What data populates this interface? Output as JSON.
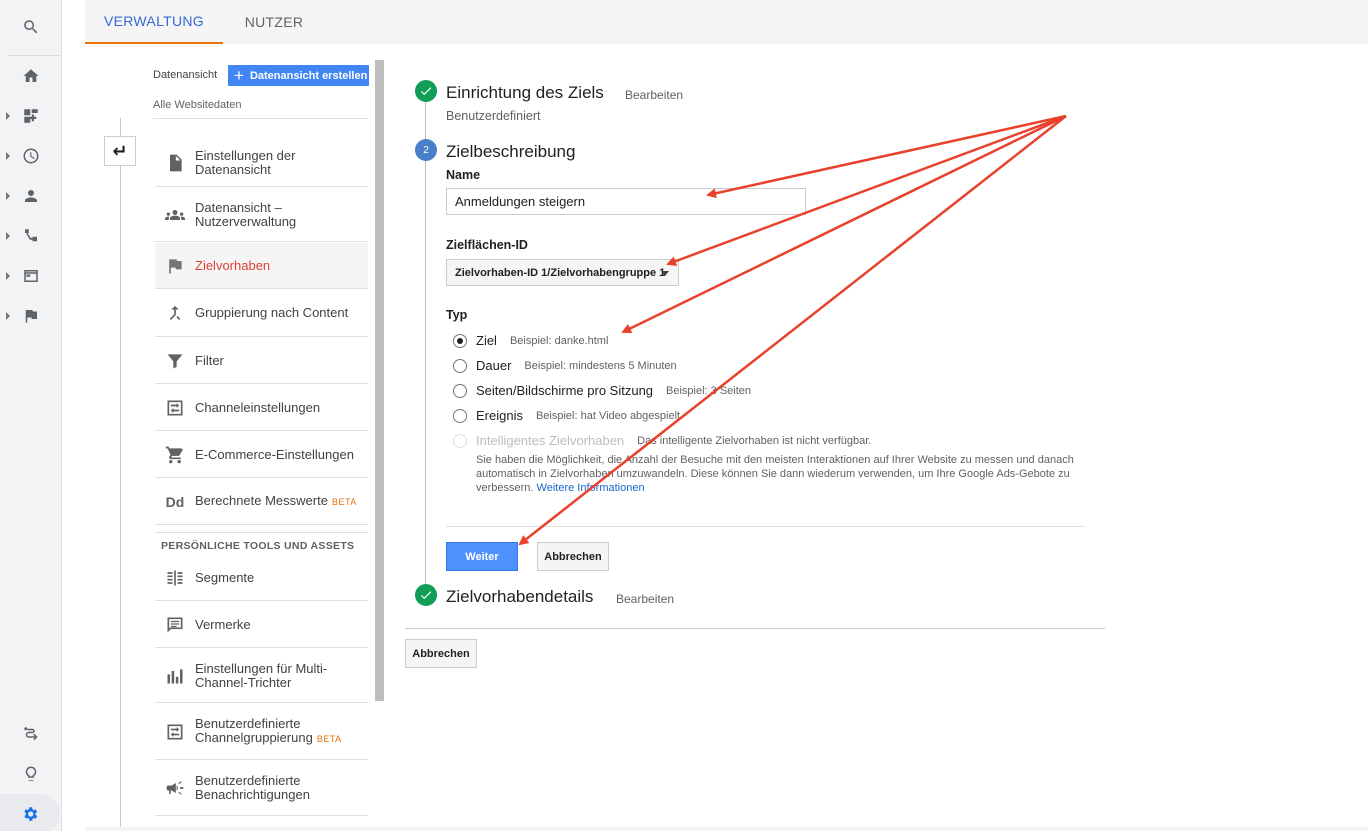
{
  "tabs": {
    "admin": "VERWALTUNG",
    "user": "NUTZER"
  },
  "rail": {
    "icons": [
      "search-icon",
      "home-icon",
      "dashboard-icon",
      "realtime-clock-icon",
      "audience-person-icon",
      "acquisition-icon",
      "behavior-icon",
      "conversions-flag-icon",
      "attribution-icon",
      "discover-bulb-icon",
      "admin-gear-icon"
    ]
  },
  "nav": {
    "view_label": "Datenansicht",
    "create_button": "Datenansicht erstellen",
    "site_data": "Alle Websitedaten",
    "items": [
      {
        "line1": "Einstellungen der",
        "line2": "Datenansicht"
      },
      {
        "line1": "Datenansicht –",
        "line2": "Nutzerverwaltung"
      },
      {
        "line1": "Zielvorhaben",
        "line2": ""
      },
      {
        "line1": "Gruppierung nach Content",
        "line2": ""
      },
      {
        "line1": "Filter",
        "line2": ""
      },
      {
        "line1": "Channeleinstellungen",
        "line2": ""
      },
      {
        "line1": "E-Commerce-Einstellungen",
        "line2": ""
      },
      {
        "line1": "Berechnete Messwerte",
        "line2": "",
        "badge": "BETA"
      },
      {
        "line1": "Segmente",
        "line2": ""
      },
      {
        "line1": "Vermerke",
        "line2": ""
      },
      {
        "line1": "Einstellungen für Multi-",
        "line2": "Channel-Trichter"
      },
      {
        "line1": "Benutzerdefinierte",
        "line2": "Channelgruppierung",
        "badge": "BETA"
      },
      {
        "line1": "Benutzerdefinierte",
        "line2": "Benachrichtigungen"
      }
    ],
    "section_head": "PERSÖNLICHE TOOLS UND ASSETS"
  },
  "form": {
    "step1_title": "Einrichtung des Ziels",
    "step1_edit": "Bearbeiten",
    "step1_sub": "Benutzerdefiniert",
    "step2_num": "2",
    "step2_title": "Zielbeschreibung",
    "name_label": "Name",
    "name_value": "Anmeldungen steigern",
    "id_label": "Zielflächen-ID",
    "id_value": "Zielvorhaben-ID 1/Zielvorhabengruppe 1",
    "type_label": "Typ",
    "types": [
      {
        "label": "Ziel",
        "hint": "Beispiel: danke.html"
      },
      {
        "label": "Dauer",
        "hint": "Beispiel: mindestens 5 Minuten"
      },
      {
        "label": "Seiten/Bildschirme pro Sitzung",
        "hint": "Beispiel: 3 Seiten"
      },
      {
        "label": "Ereignis",
        "hint": "Beispiel: hat Video abgespielt"
      },
      {
        "label": "Intelligentes Zielvorhaben",
        "hint": "Das intelligente Zielvorhaben ist nicht verfügbar."
      }
    ],
    "smart_text": "Sie haben die Möglichkeit, die Anzahl der Besuche mit den meisten Interaktionen auf Ihrer Website zu messen und danach automatisch in Zielvorhaben umzuwandeln. Diese können Sie dann wiederum verwenden, um Ihre Google Ads-Gebote zu verbessern.",
    "more_info": "Weitere Informationen",
    "continue_btn": "Weiter",
    "cancel_btn": "Abbrechen",
    "step3_title": "Zielvorhabendetails",
    "step3_edit": "Bearbeiten",
    "bottom_cancel": "Abbrechen"
  },
  "colors": {
    "accent": "#4285f4",
    "tab_underline": "#e8710a",
    "active_nav": "#db4437",
    "check": "#0f9d58",
    "arrow": "#e8412c"
  }
}
